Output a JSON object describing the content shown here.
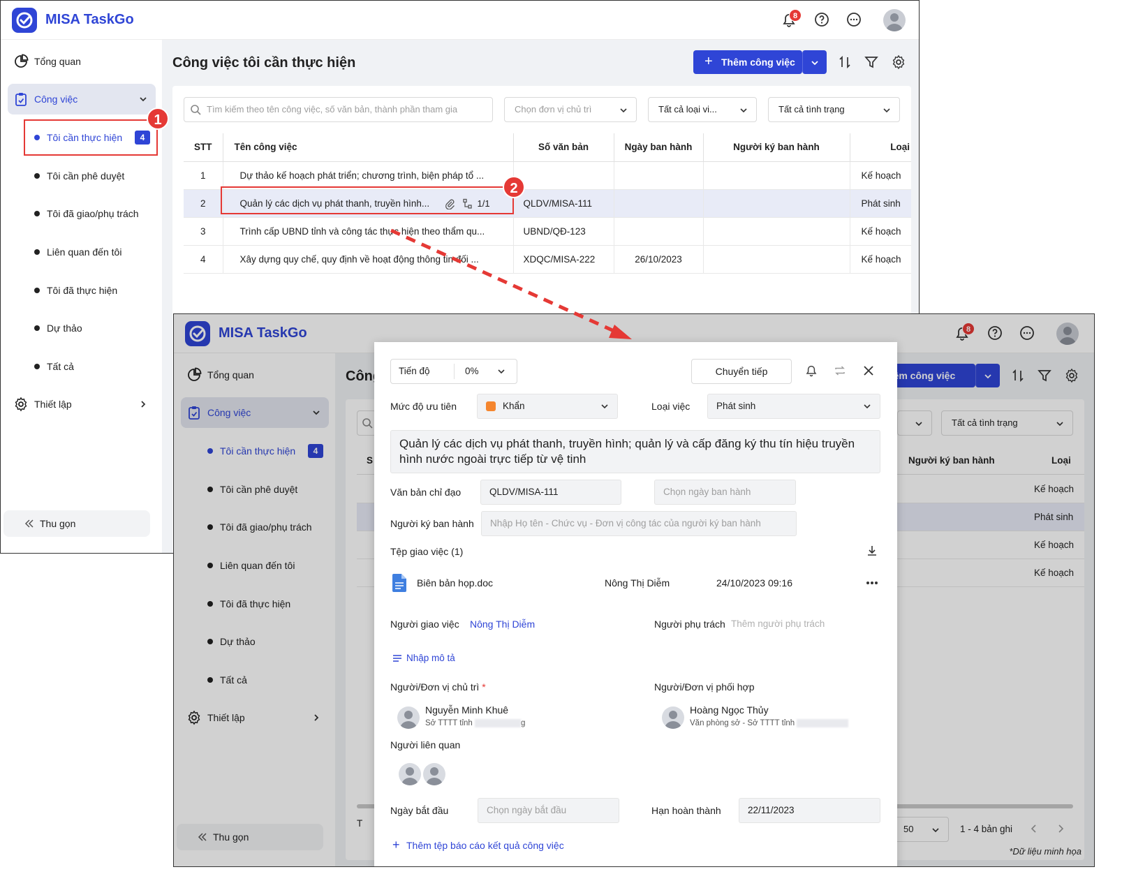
{
  "app": {
    "name": "MISA TaskGo",
    "notification_count": "8"
  },
  "sidebar": {
    "overview": "Tổng quan",
    "work": "Công việc",
    "sub_items": [
      {
        "label": "Tôi cần thực hiện",
        "count": "4",
        "active": true
      },
      {
        "label": "Tôi cần phê duyệt"
      },
      {
        "label": "Tôi đã giao/phụ trách"
      },
      {
        "label": "Liên quan đến tôi"
      },
      {
        "label": "Tôi đã thực hiện"
      },
      {
        "label": "Dự thảo"
      },
      {
        "label": "Tất cả"
      }
    ],
    "settings": "Thiết lập",
    "collapse": "Thu gọn"
  },
  "page": {
    "title": "Công việc tôi cần thực hiện",
    "title_partial": "Công",
    "add_button": "Thêm công việc",
    "add_button_partial": "hêm công việc"
  },
  "filters": {
    "search_placeholder": "Tìm kiếm theo tên công việc, số văn bản, thành phần tham gia",
    "unit": "Chọn đơn vị chủ trì",
    "type": "Tất cả loại vi...",
    "status": "Tất cả tình trạng"
  },
  "table": {
    "headers": [
      "STT",
      "Tên công việc",
      "Số văn bản",
      "Ngày ban hành",
      "Người ký ban hành",
      "Loại"
    ],
    "rows": [
      {
        "stt": "1",
        "name": "Dự thảo kế hoạch phát triển; chương trình, biện pháp tổ ...",
        "so": "",
        "date": "",
        "signer": "",
        "type": "Kế hoạch"
      },
      {
        "stt": "2",
        "name": "Quản lý các dịch vụ phát thanh, truyền hình...",
        "so": "QLDV/MISA-111",
        "date": "",
        "signer": "",
        "type": "Phát sinh",
        "subtask": "1/1"
      },
      {
        "stt": "3",
        "name": "Trình cấp UBND tỉnh và công tác thực hiện theo thẩm qu...",
        "so": "UBND/QĐ-123",
        "date": "",
        "signer": "",
        "type": "Kế hoạch"
      },
      {
        "stt": "4",
        "name": "Xây dựng quy chế, quy định về hoạt động thông tin đối ...",
        "so": "XDQC/MISA-222",
        "date": "26/10/2023",
        "signer": "",
        "type": "Kế hoạch"
      }
    ]
  },
  "callouts": [
    "1",
    "2"
  ],
  "detail": {
    "progress_label": "Tiến độ",
    "progress_value": "0%",
    "forward_button": "Chuyển tiếp",
    "priority_label": "Mức độ ưu tiên",
    "priority_value": "Khẩn",
    "priority_color": "#f5862f",
    "work_type_label": "Loại việc",
    "work_type_value": "Phát sinh",
    "title": "Quản lý các dịch vụ phát thanh, truyền hình; quản lý và cấp đăng ký thu tín hiệu truyền hình nước ngoài trực tiếp từ vệ tinh",
    "directive_label": "Văn bản chỉ đạo",
    "directive_value": "QLDV/MISA-111",
    "issue_date_placeholder": "Chọn ngày ban hành",
    "signer_label": "Người ký ban hành",
    "signer_placeholder": "Nhập Họ tên - Chức vụ - Đơn vị công tác của người ký ban hành",
    "files_label": "Tệp giao việc (1)",
    "file": {
      "name": "Biên bản họp.doc",
      "owner": "Nông Thị Diễm",
      "time": "24/10/2023 09:16"
    },
    "assigner_label": "Người giao việc",
    "assigner_value": "Nông Thị Diễm",
    "responsible_label": "Người phụ trách",
    "responsible_placeholder": "Thêm người phụ trách",
    "description_placeholder": "Nhập mô tả",
    "host_label": "Người/Đơn vị chủ trì",
    "required_mark": "*",
    "host": {
      "name": "Nguyễn Minh Khuê",
      "unit_prefix": "Sở TTTT tỉnh",
      "unit_suffix": "g"
    },
    "coord_label": "Người/Đơn vị phối hợp",
    "coord": {
      "name": "Hoàng Ngọc Thủy",
      "unit_prefix": "Văn phòng sở - Sở TTTT tỉnh"
    },
    "related_label": "Người liên quan",
    "start_label": "Ngày bắt đầu",
    "start_placeholder": "Chọn ngày bắt đầu",
    "deadline_label": "Hạn hoàn thành",
    "deadline_value": "22/11/2023",
    "add_report": "Thêm tệp báo cáo kết quả công việc"
  },
  "screen2_table": {
    "header_partial": "S",
    "signer_header": "Người ký ban hành",
    "type_header": "Loại",
    "types": [
      "Kế hoạch",
      "Phát sinh",
      "Kế hoạch",
      "Kế hoạch"
    ]
  },
  "pagination": {
    "page_size": "50",
    "range": "1 - 4 bản ghi",
    "footer_partial": "T"
  },
  "footnote": "*Dữ liệu minh họa"
}
